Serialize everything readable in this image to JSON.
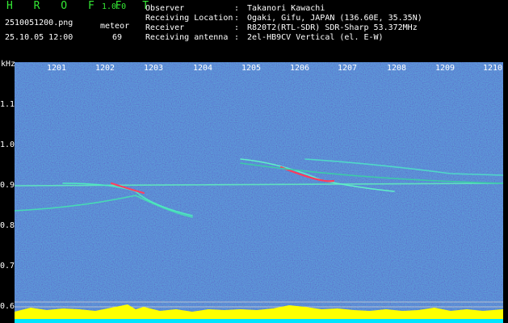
{
  "app": {
    "name": "H R O F F T",
    "version": "1.0.0"
  },
  "file": {
    "name": "2510051200.png",
    "datetime": "25.10.05 12:00"
  },
  "meteor": {
    "label": "meteor",
    "count": "69"
  },
  "info": [
    {
      "label": "Observer",
      "value": "Takanori Kawachi"
    },
    {
      "label": "Receiving Location",
      "value": "Ogaki, Gifu, JAPAN (136.60E, 35.35N)"
    },
    {
      "label": "Receiver",
      "value": "R820T2(RTL-SDR) SDR-Sharp 53.372MHz"
    },
    {
      "label": "Receiving antenna",
      "value": "2el-HB9CV Vertical (el. E-W)"
    }
  ],
  "separator": ":",
  "axis": {
    "ylabel": "kHz",
    "xticks": [
      "1201",
      "1202",
      "1203",
      "1204",
      "1205",
      "1206",
      "1207",
      "1208",
      "1209",
      "1210"
    ],
    "yticks": [
      "1.1",
      "1.0",
      "0.9",
      "0.8",
      "0.7",
      "0.6"
    ]
  },
  "colors": {
    "background": "#0a1a8a",
    "text_accent": "#34e834",
    "signal": "#7fffd4",
    "spectrum": "#ffff00",
    "baseline": "#00e5ff"
  }
}
